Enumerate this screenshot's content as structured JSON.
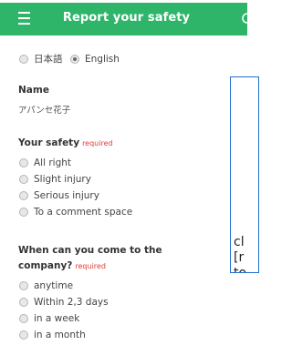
{
  "header": {
    "title": "Report your safety",
    "menu_icon": "hamburger-menu-icon",
    "reload_icon": "reload-icon",
    "bg_color": "#2fb56a"
  },
  "language": {
    "options": [
      {
        "label": "日本語",
        "selected": false
      },
      {
        "label": "English",
        "selected": true
      }
    ]
  },
  "name_section": {
    "label": "Name",
    "value": "アパンセ花子"
  },
  "safety_section": {
    "label": "Your safety",
    "required": "required",
    "options": [
      "All right",
      "Slight injury",
      "Serious injury",
      "To a comment space"
    ]
  },
  "company_section": {
    "label_line1": "When can you come to the",
    "label_line2": "company?",
    "required": "required",
    "options": [
      "anytime",
      "Within 2,3 days",
      "in a week",
      "in a month"
    ]
  },
  "popup": {
    "lines": [
      "cl",
      "[r",
      "to"
    ]
  }
}
